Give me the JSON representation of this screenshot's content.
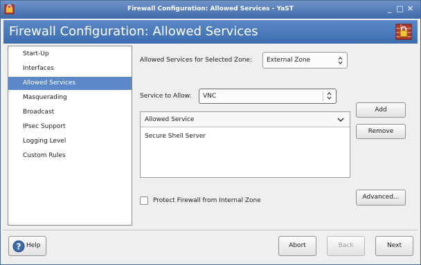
{
  "window": {
    "title": "Firewall Configuration: Allowed Services - YaST",
    "controls": [
      "minimize-icon",
      "maximize-icon",
      "close-icon"
    ]
  },
  "banner": {
    "heading": "Firewall Configuration: Allowed Services",
    "icon": "firewall-icon"
  },
  "sidebar": {
    "items": [
      {
        "label": "Start-Up",
        "selected": false
      },
      {
        "label": "Interfaces",
        "selected": false
      },
      {
        "label": "Allowed Services",
        "selected": true
      },
      {
        "label": "Masquerading",
        "selected": false
      },
      {
        "label": "Broadcast",
        "selected": false
      },
      {
        "label": "IPsec Support",
        "selected": false
      },
      {
        "label": "Logging Level",
        "selected": false
      },
      {
        "label": "Custom Rules",
        "selected": false
      }
    ]
  },
  "main": {
    "zone_label": "Allowed Services for Selected Zone:",
    "zone_value": "External Zone",
    "service_label": "Service to Allow:",
    "service_value": "VNC",
    "list_header": "Allowed Service",
    "list_items": [
      "Secure Shell Server"
    ],
    "add_label": "Add",
    "remove_label": "Remove",
    "protect_label": "Protect Firewall from Internal Zone",
    "protect_checked": false,
    "advanced_label": "Advanced..."
  },
  "footer": {
    "help_label": "Help",
    "abort_label": "Abort",
    "back_label": "Back",
    "next_label": "Next"
  },
  "colors": {
    "accent": "#5b88c6",
    "title_bar": "#3f6aa8"
  }
}
